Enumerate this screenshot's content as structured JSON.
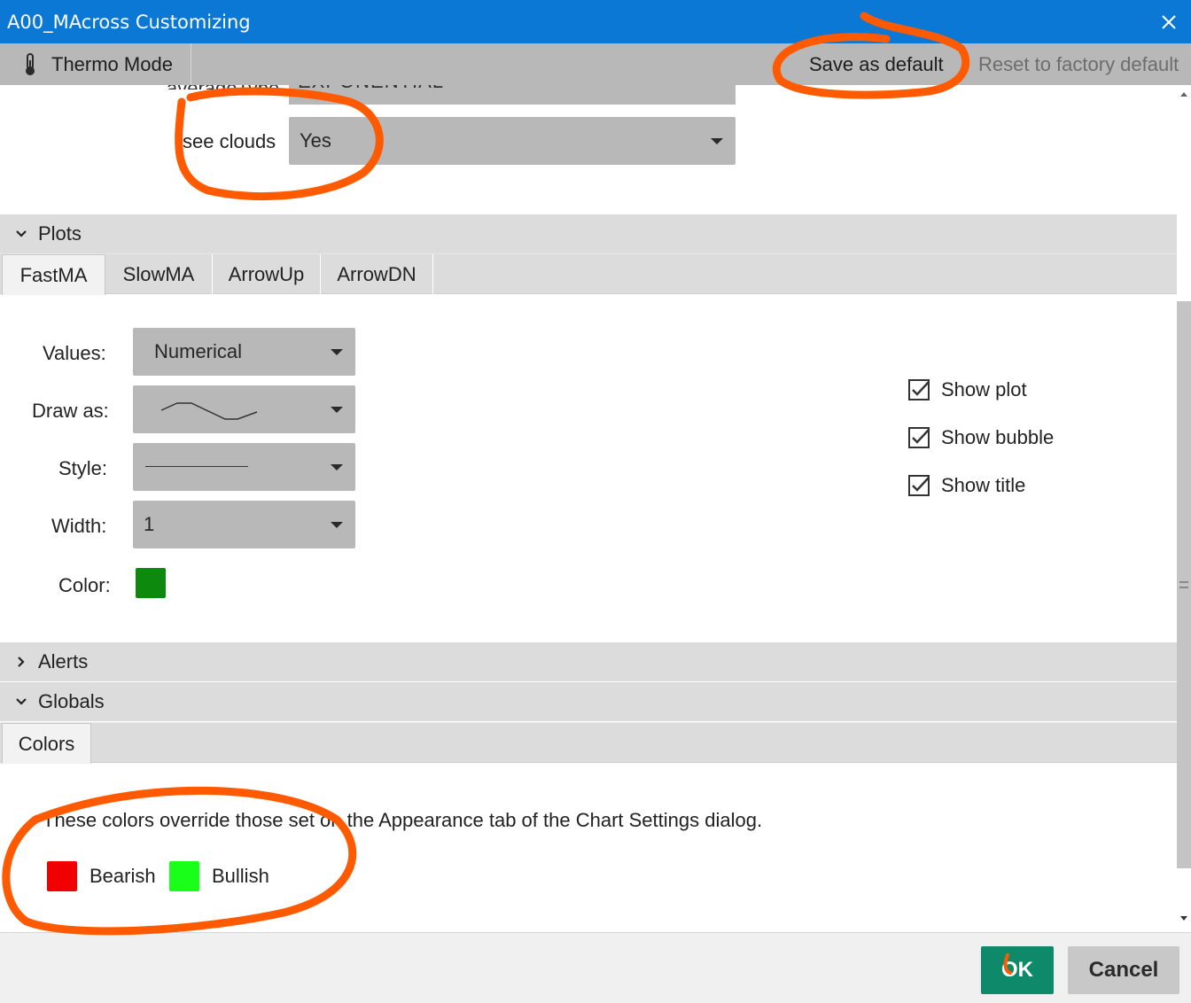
{
  "window": {
    "title": "A00_MAcross Customizing"
  },
  "toolbar": {
    "thermo_label": "Thermo Mode",
    "save_default_label": "Save as default",
    "reset_default_label": "Reset to factory default"
  },
  "inputs": {
    "cut_value": "EXPONENTIAL",
    "see_clouds_label": "see clouds",
    "see_clouds_value": "Yes"
  },
  "plots": {
    "header": "Plots",
    "tabs": [
      {
        "label": "FastMA"
      },
      {
        "label": "SlowMA"
      },
      {
        "label": "ArrowUp"
      },
      {
        "label": "ArrowDN"
      }
    ],
    "values_label": "Values:",
    "values_value": "Numerical",
    "draw_as_label": "Draw as:",
    "style_label": "Style:",
    "width_label": "Width:",
    "width_value": "1",
    "color_label": "Color:",
    "color": "#0d8a0d",
    "show_plot": "Show plot",
    "show_bubble": "Show bubble",
    "show_title": "Show title"
  },
  "alerts": {
    "header": "Alerts"
  },
  "globals": {
    "header": "Globals",
    "tab": "Colors",
    "note": "These colors override those set on the Appearance tab of the Chart Settings dialog.",
    "bearish_label": "Bearish",
    "bearish_color": "#f00000",
    "bullish_label": "Bullish",
    "bullish_color": "#1aff1a"
  },
  "footer": {
    "ok_label": "OK",
    "cancel_label": "Cancel"
  },
  "colors": {
    "titlebar": "#0a78d4",
    "ok_button": "#0e8a6a",
    "annotation": "#ff5a00"
  }
}
